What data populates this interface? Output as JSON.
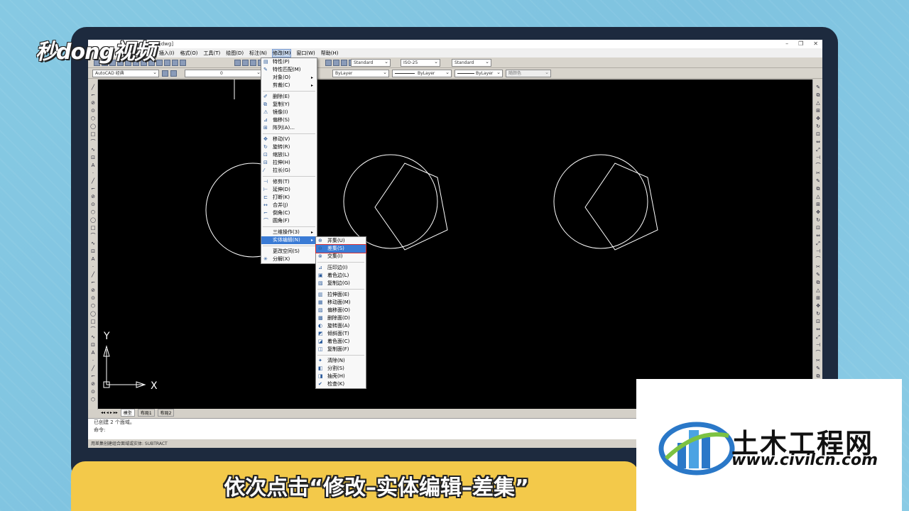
{
  "branding": {
    "logo": "秒dong视频",
    "subtitle": "依次点击“修改–实体编辑–差集”",
    "watermark_title": "土木工程网",
    "watermark_url": "www.civilcn.com"
  },
  "titlebar": {
    "doc": "[dwg]"
  },
  "menubar": [
    {
      "label": "插入(I)"
    },
    {
      "label": "格式(O)"
    },
    {
      "label": "工具(T)"
    },
    {
      "label": "绘图(D)"
    },
    {
      "label": "标注(N)"
    },
    {
      "label": "修改(M)",
      "active": true
    },
    {
      "label": "窗口(W)"
    },
    {
      "label": "帮助(H)"
    }
  ],
  "toolbar": {
    "workspace": "AutoCAD 经典",
    "layer": "0",
    "text_style": "Standard",
    "dim_style": "ISO-25",
    "table_style": "Standard",
    "color": "ByLayer",
    "linetype": "ByLayer",
    "lineweight": "ByLayer",
    "plot_style": "随颜色"
  },
  "modify_menu": [
    {
      "label": "特性(P)",
      "icon": "properties-icon"
    },
    {
      "label": "特性匹配(M)",
      "icon": "match-properties-icon"
    },
    {
      "label": "对象(O)",
      "submenu": true
    },
    {
      "label": "剪裁(C)",
      "submenu": true
    },
    {
      "sep": true
    },
    {
      "label": "删除(E)",
      "icon": "erase-icon"
    },
    {
      "label": "复制(Y)",
      "icon": "copy-icon"
    },
    {
      "label": "镜像(I)",
      "icon": "mirror-icon"
    },
    {
      "label": "偏移(S)",
      "icon": "offset-icon"
    },
    {
      "label": "阵列(A)...",
      "icon": "array-icon"
    },
    {
      "sep": true
    },
    {
      "label": "移动(V)",
      "icon": "move-icon"
    },
    {
      "label": "旋转(R)",
      "icon": "rotate-icon"
    },
    {
      "label": "缩放(L)",
      "icon": "scale-icon"
    },
    {
      "label": "拉伸(H)",
      "icon": "stretch-icon"
    },
    {
      "label": "拉长(G)",
      "icon": "lengthen-icon"
    },
    {
      "sep": true
    },
    {
      "label": "修剪(T)",
      "icon": "trim-icon"
    },
    {
      "label": "延伸(D)",
      "icon": "extend-icon"
    },
    {
      "label": "打断(K)",
      "icon": "break-icon"
    },
    {
      "label": "合并(J)",
      "icon": "join-icon"
    },
    {
      "label": "倒角(C)",
      "icon": "chamfer-icon"
    },
    {
      "label": "圆角(F)",
      "icon": "fillet-icon"
    },
    {
      "sep": true
    },
    {
      "label": "三维操作(3)",
      "submenu": true
    },
    {
      "label": "实体编辑(N)",
      "submenu": true,
      "highlight": true
    },
    {
      "sep": true
    },
    {
      "label": "更改空间(S)"
    },
    {
      "label": "分解(X)",
      "icon": "explode-icon"
    }
  ],
  "solid_edit_menu": [
    {
      "label": "并集(U)",
      "icon": "union-icon"
    },
    {
      "label": "差集(S)",
      "icon": "subtract-icon",
      "highlight": true
    },
    {
      "label": "交集(I)",
      "icon": "intersect-icon"
    },
    {
      "sep": true
    },
    {
      "label": "压印边(I)",
      "icon": "imprint-icon"
    },
    {
      "label": "着色边(L)",
      "icon": "color-edges-icon"
    },
    {
      "label": "复制边(G)",
      "icon": "copy-edges-icon"
    },
    {
      "sep": true
    },
    {
      "label": "拉伸面(E)",
      "icon": "extrude-faces-icon"
    },
    {
      "label": "移动面(M)",
      "icon": "move-faces-icon"
    },
    {
      "label": "偏移面(O)",
      "icon": "offset-faces-icon"
    },
    {
      "label": "删除面(D)",
      "icon": "delete-faces-icon"
    },
    {
      "label": "旋转面(A)",
      "icon": "rotate-faces-icon"
    },
    {
      "label": "倾斜面(T)",
      "icon": "taper-faces-icon"
    },
    {
      "label": "着色面(C)",
      "icon": "color-faces-icon"
    },
    {
      "label": "复制面(F)",
      "icon": "copy-faces-icon"
    },
    {
      "sep": true
    },
    {
      "label": "清除(N)",
      "icon": "clean-icon"
    },
    {
      "label": "分割(S)",
      "icon": "separate-icon"
    },
    {
      "label": "抽壳(H)",
      "icon": "shell-icon"
    },
    {
      "label": "检查(K)",
      "icon": "check-icon"
    }
  ],
  "layout_tabs": [
    "模型",
    "布局1",
    "布局2"
  ],
  "command": {
    "history": "已创建 2 个面域。",
    "prompt": "命令:"
  },
  "statusbar": "用差集创建组合面域或实体:   SUBTRACT",
  "ucs": {
    "x": "X",
    "y": "Y"
  },
  "colors": {
    "canvas": "#000000",
    "menu_highlight": "#3a7bd5",
    "subtitle_bar": "#f3c94a"
  }
}
